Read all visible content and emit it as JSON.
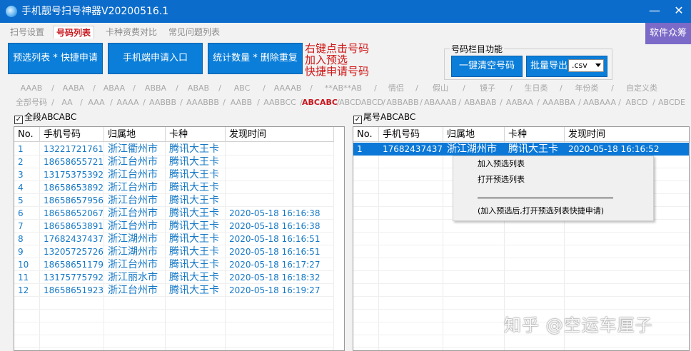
{
  "window": {
    "title": "手机靓号扫号神器V20200516.1",
    "minimize": "—",
    "close": "✕"
  },
  "tabs": [
    "扫号设置",
    "号码列表",
    "卡种资费对比",
    "常见问题列表"
  ],
  "active_tab": 1,
  "brand_button": "软件众筹",
  "buttons": {
    "preselect": "预选列表 * 快捷申请",
    "mobile_entry": "手机端申请入口",
    "count_dedup": "统计数量 * 删除重复"
  },
  "hint_lines": [
    "右键点击号码",
    "加入预选",
    "快捷申请号码"
  ],
  "number_column": {
    "label": "号码栏目功能",
    "clear_button": "一键清空号码",
    "export_button": "批量导出",
    "export_format": ".csv"
  },
  "filters_row1": [
    "AAAB",
    "AABA",
    "ABAA",
    "ABBA",
    "ABAB",
    "ABC",
    "AAAAB",
    "**AB**AB",
    "情侣",
    "假山",
    "镜子",
    "生日类",
    "年份类",
    "自定义类"
  ],
  "filters_row2": [
    "全部号码",
    "AA",
    "AAA",
    "AAAA",
    "AABBB",
    "AAABBB",
    "AABB",
    "AABBCC",
    "ABCABC",
    "ABCDABCD",
    "ABBABB",
    "ABAAAB",
    "ABABAB",
    "AABAA",
    "AAABBA",
    "AABAAA",
    "ABCD",
    "ABCDE"
  ],
  "active_filter": "ABCABC",
  "left_panel": {
    "checkbox_label": "全段ABCABC",
    "checked": true,
    "columns": [
      "No.",
      "手机号码",
      "归属地",
      "卡种",
      "发现时间"
    ],
    "rows": [
      [
        "1",
        "13221721761",
        "浙江衢州市",
        "腾讯大王卡",
        ""
      ],
      [
        "2",
        "18658655721",
        "浙江台州市",
        "腾讯大王卡",
        ""
      ],
      [
        "3",
        "13175375392",
        "浙江台州市",
        "腾讯大王卡",
        ""
      ],
      [
        "4",
        "18658653892",
        "浙江台州市",
        "腾讯大王卡",
        ""
      ],
      [
        "5",
        "18658657956",
        "浙江台州市",
        "腾讯大王卡",
        ""
      ],
      [
        "6",
        "18658652067",
        "浙江台州市",
        "腾讯大王卡",
        "2020-05-18 16:16:38"
      ],
      [
        "7",
        "18658653891",
        "浙江台州市",
        "腾讯大王卡",
        "2020-05-18 16:16:38"
      ],
      [
        "8",
        "17682437437",
        "浙江湖州市",
        "腾讯大王卡",
        "2020-05-18 16:16:51"
      ],
      [
        "9",
        "13205725726",
        "浙江湖州市",
        "腾讯大王卡",
        "2020-05-18 16:16:51"
      ],
      [
        "10",
        "18658651179",
        "浙江台州市",
        "腾讯大王卡",
        "2020-05-18 16:17:27"
      ],
      [
        "11",
        "13175775792",
        "浙江丽水市",
        "腾讯大王卡",
        "2020-05-18 16:18:32"
      ],
      [
        "12",
        "18658651923",
        "浙江台州市",
        "腾讯大王卡",
        "2020-05-18 16:19:27"
      ]
    ]
  },
  "right_panel": {
    "checkbox_label": "尾号ABCABC",
    "checked": true,
    "columns": [
      "No.",
      "手机号码",
      "归属地",
      "卡种",
      "发现时间"
    ],
    "rows": [
      [
        "1",
        "17682437437",
        "浙江湖州市",
        "腾讯大王卡",
        "2020-05-18 16:16:52"
      ]
    ],
    "selected_row": 0
  },
  "context_menu": {
    "items": [
      "加入预选列表",
      "打开预选列表",
      "(加入预选后,打开预选列表快捷申请)"
    ]
  },
  "watermark": "知乎 @空运车厘子",
  "colors": {
    "titlebar": "#0b6ccb",
    "button": "#0a7ed9",
    "accent_red": "#c8161d",
    "hint_red": "#d01515",
    "row_text": "#1578c6",
    "selection": "#0b78d7",
    "brand_button": "#7c6ac8"
  }
}
